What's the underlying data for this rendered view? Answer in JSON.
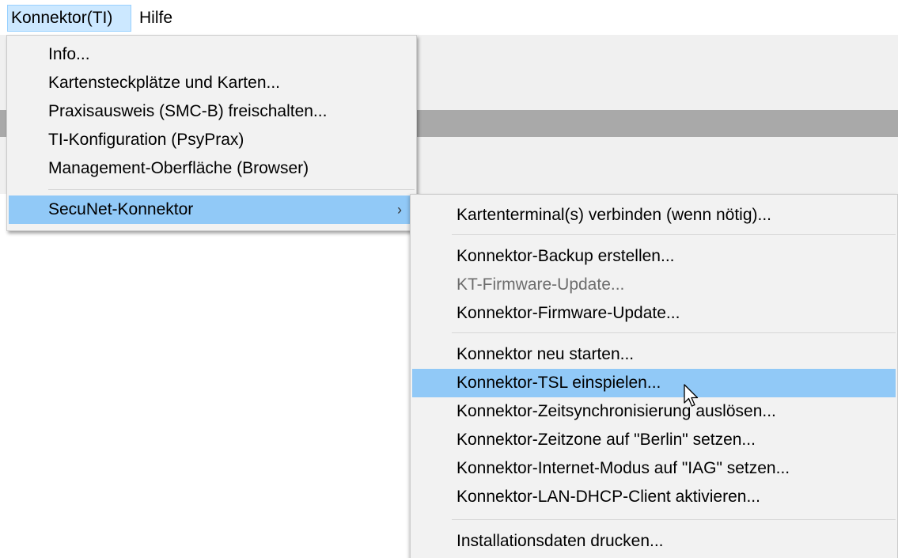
{
  "menubar": {
    "items": [
      {
        "label": "Konnektor(TI)"
      },
      {
        "label": "Hilfe"
      }
    ]
  },
  "main_menu": {
    "items": [
      {
        "label": "Info..."
      },
      {
        "label": "Kartensteckplätze und Karten..."
      },
      {
        "label": "Praxisausweis (SMC-B) freischalten..."
      },
      {
        "label": "TI-Konfiguration (PsyPrax)"
      },
      {
        "label": "Management-Oberfläche (Browser)"
      },
      {
        "label": "SecuNet-Konnektor",
        "submenu_arrow": "›"
      }
    ]
  },
  "submenu": {
    "items": [
      {
        "label": "Kartenterminal(s) verbinden (wenn nötig)..."
      },
      {
        "label": "Konnektor-Backup erstellen..."
      },
      {
        "label": "KT-Firmware-Update...",
        "disabled": true
      },
      {
        "label": "Konnektor-Firmware-Update..."
      },
      {
        "label": "Konnektor neu starten..."
      },
      {
        "label": "Konnektor-TSL einspielen...",
        "highlighted": true
      },
      {
        "label": "Konnektor-Zeitsynchronisierung auslösen..."
      },
      {
        "label": "Konnektor-Zeitzone auf \"Berlin\" setzen..."
      },
      {
        "label": "Konnektor-Internet-Modus auf \"IAG\" setzen..."
      },
      {
        "label": "Konnektor-LAN-DHCP-Client aktivieren..."
      },
      {
        "label": "Installationsdaten drucken..."
      }
    ]
  },
  "colors": {
    "menubar_open": "#cce8ff",
    "highlight": "#91c9f7",
    "menu_bg": "#f2f2f2",
    "disabled_text": "#6d6d6d"
  },
  "icons": {
    "cursor": "mouse-pointer-icon"
  }
}
